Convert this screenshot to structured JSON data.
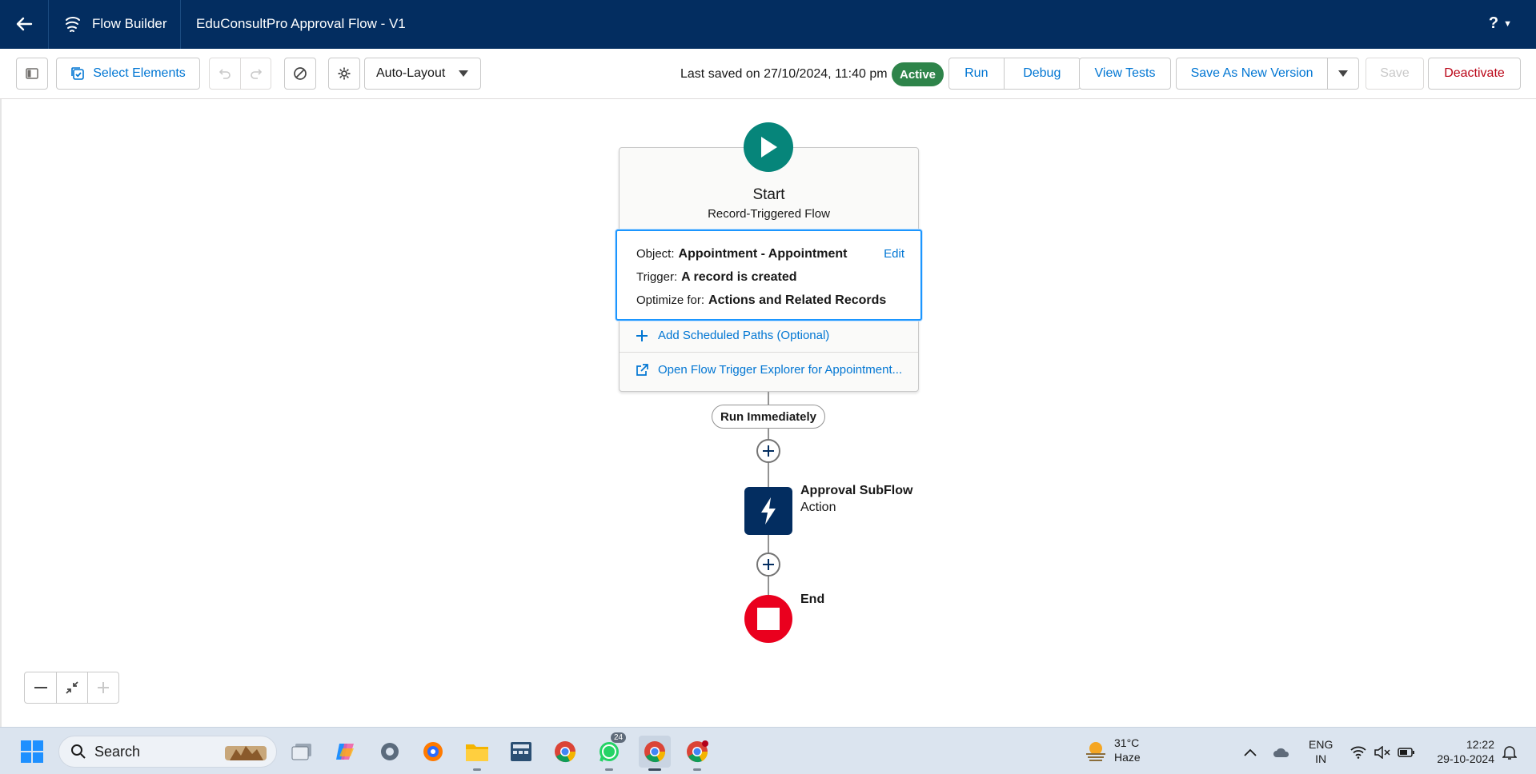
{
  "header": {
    "app_name": "Flow Builder",
    "flow_title": "EduConsultPro Approval Flow - V1",
    "help_label": "?"
  },
  "toolbar": {
    "select_elements_label": "Select Elements",
    "layout_select_value": "Auto-Layout",
    "last_saved": "Last saved on 27/10/2024, 11:40 pm",
    "status_badge": "Active",
    "run_label": "Run",
    "debug_label": "Debug",
    "view_tests_label": "View Tests",
    "save_as_new_version_label": "Save As New Version",
    "save_label": "Save",
    "deactivate_label": "Deactivate"
  },
  "canvas": {
    "start": {
      "title": "Start",
      "subtitle": "Record-Triggered Flow",
      "object_label": "Object:",
      "object_value": "Appointment - Appointment",
      "trigger_label": "Trigger:",
      "trigger_value": "A record is created",
      "optimize_label": "Optimize for:",
      "optimize_value": "Actions and Related Records",
      "edit_label": "Edit",
      "add_scheduled_paths": "Add Scheduled Paths (Optional)",
      "open_trigger_explorer": "Open Flow Trigger Explorer for Appointment..."
    },
    "path_label": "Run Immediately",
    "action_node": {
      "title": "Approval SubFlow",
      "type": "Action"
    },
    "end_node": {
      "title": "End"
    }
  },
  "taskbar": {
    "search_label": "Search",
    "whatsapp_badge": "24",
    "weather_temp": "31°C",
    "weather_desc": "Haze",
    "lang_line1": "ENG",
    "lang_line2": "IN",
    "time": "12:22",
    "date": "29-10-2024"
  },
  "colors": {
    "header_bg": "#032d60",
    "brand_blue": "#0176d3",
    "active_green": "#2e844a",
    "start_teal": "#06857a",
    "end_red": "#ea001e",
    "deactivate_red": "#ba0517"
  }
}
